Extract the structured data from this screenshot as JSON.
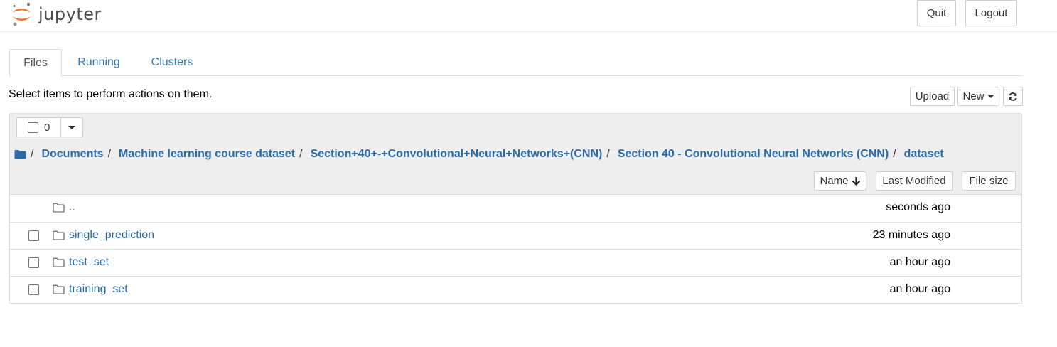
{
  "header": {
    "logo_text": "jupyter",
    "quit_label": "Quit",
    "logout_label": "Logout"
  },
  "tabs": [
    {
      "label": "Files",
      "active": true
    },
    {
      "label": "Running",
      "active": false
    },
    {
      "label": "Clusters",
      "active": false
    }
  ],
  "toolbar": {
    "hint": "Select items to perform actions on them.",
    "upload_label": "Upload",
    "new_label": "New",
    "refresh_icon": "refresh-icon"
  },
  "selection": {
    "count": "0"
  },
  "breadcrumb": [
    {
      "label": "Documents"
    },
    {
      "label": "Machine learning course dataset"
    },
    {
      "label": "Section+40+-+Convolutional+Neural+Networks+(CNN)"
    },
    {
      "label": "Section 40 - Convolutional Neural Networks (CNN)"
    },
    {
      "label": "dataset"
    }
  ],
  "list_header": {
    "name_label": "Name",
    "modified_label": "Last Modified",
    "size_label": "File size"
  },
  "files": [
    {
      "name": "..",
      "modified": "seconds ago",
      "checkbox": false,
      "icon": "folder-icon"
    },
    {
      "name": "single_prediction",
      "modified": "23 minutes ago",
      "checkbox": true,
      "icon": "folder-icon"
    },
    {
      "name": "test_set",
      "modified": "an hour ago",
      "checkbox": true,
      "icon": "folder-icon"
    },
    {
      "name": "training_set",
      "modified": "an hour ago",
      "checkbox": true,
      "icon": "folder-icon"
    }
  ],
  "colors": {
    "link": "#2a6aa6",
    "tab_link": "#337ab7",
    "logo_orange": "#f37626",
    "panel_header_bg": "#eeeeee"
  }
}
